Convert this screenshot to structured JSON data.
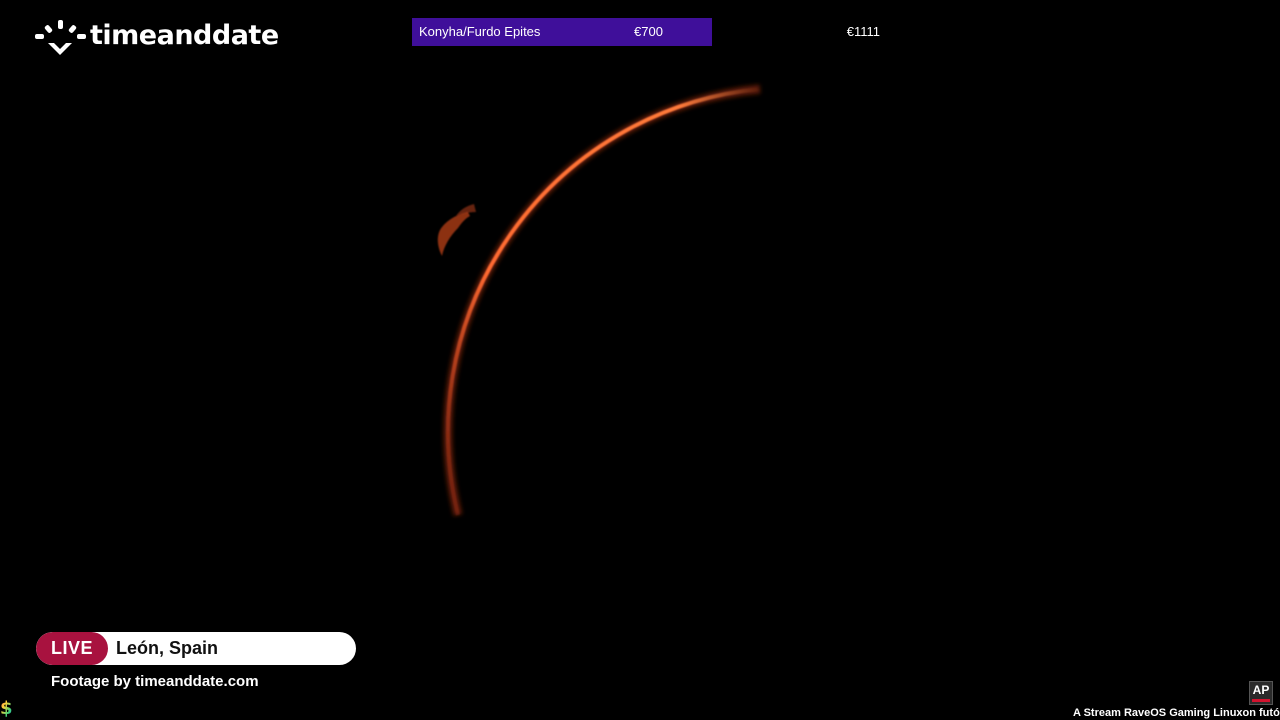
{
  "logo": {
    "text": "timeanddate",
    "icon": "sunburst-logo-icon"
  },
  "donation_goal": {
    "label": "Konyha/Furdo Epites",
    "current": "€700",
    "target": "€1111",
    "progress_fraction": 0.63,
    "fill_color": "#3f0f9a"
  },
  "stream": {
    "live_label": "LIVE",
    "location": "León, Spain",
    "credit": "Footage by timeanddate.com",
    "live_color": "#a8123f"
  },
  "watermark": {
    "ap_label": "AP",
    "ticker_text": "A Stream RaveOS Gaming Linuxon futó"
  },
  "icons": {
    "coin": "coin-icon"
  }
}
